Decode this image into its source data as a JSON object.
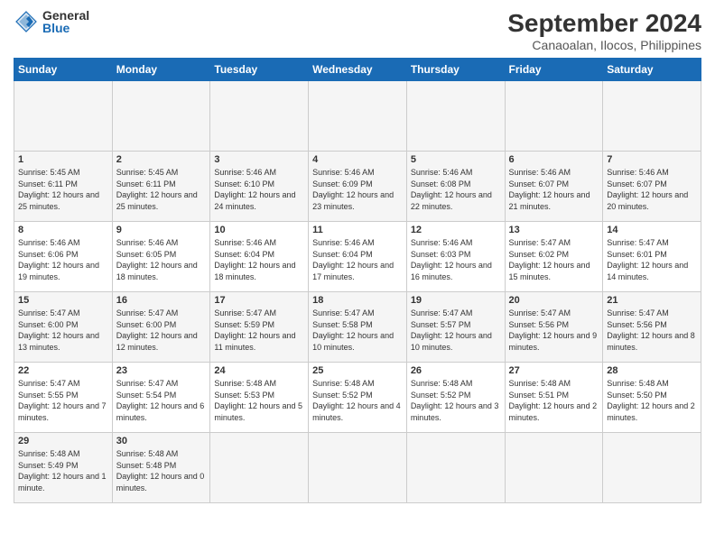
{
  "header": {
    "logo_general": "General",
    "logo_blue": "Blue",
    "title": "September 2024",
    "subtitle": "Canaoalan, Ilocos, Philippines"
  },
  "calendar": {
    "headers": [
      "Sunday",
      "Monday",
      "Tuesday",
      "Wednesday",
      "Thursday",
      "Friday",
      "Saturday"
    ],
    "weeks": [
      [
        {
          "day": "",
          "info": ""
        },
        {
          "day": "",
          "info": ""
        },
        {
          "day": "",
          "info": ""
        },
        {
          "day": "",
          "info": ""
        },
        {
          "day": "",
          "info": ""
        },
        {
          "day": "",
          "info": ""
        },
        {
          "day": "",
          "info": ""
        }
      ],
      [
        {
          "day": "1",
          "sunrise": "Sunrise: 5:45 AM",
          "sunset": "Sunset: 6:11 PM",
          "daylight": "Daylight: 12 hours and 25 minutes."
        },
        {
          "day": "2",
          "sunrise": "Sunrise: 5:45 AM",
          "sunset": "Sunset: 6:11 PM",
          "daylight": "Daylight: 12 hours and 25 minutes."
        },
        {
          "day": "3",
          "sunrise": "Sunrise: 5:46 AM",
          "sunset": "Sunset: 6:10 PM",
          "daylight": "Daylight: 12 hours and 24 minutes."
        },
        {
          "day": "4",
          "sunrise": "Sunrise: 5:46 AM",
          "sunset": "Sunset: 6:09 PM",
          "daylight": "Daylight: 12 hours and 23 minutes."
        },
        {
          "day": "5",
          "sunrise": "Sunrise: 5:46 AM",
          "sunset": "Sunset: 6:08 PM",
          "daylight": "Daylight: 12 hours and 22 minutes."
        },
        {
          "day": "6",
          "sunrise": "Sunrise: 5:46 AM",
          "sunset": "Sunset: 6:07 PM",
          "daylight": "Daylight: 12 hours and 21 minutes."
        },
        {
          "day": "7",
          "sunrise": "Sunrise: 5:46 AM",
          "sunset": "Sunset: 6:07 PM",
          "daylight": "Daylight: 12 hours and 20 minutes."
        }
      ],
      [
        {
          "day": "8",
          "sunrise": "Sunrise: 5:46 AM",
          "sunset": "Sunset: 6:06 PM",
          "daylight": "Daylight: 12 hours and 19 minutes."
        },
        {
          "day": "9",
          "sunrise": "Sunrise: 5:46 AM",
          "sunset": "Sunset: 6:05 PM",
          "daylight": "Daylight: 12 hours and 18 minutes."
        },
        {
          "day": "10",
          "sunrise": "Sunrise: 5:46 AM",
          "sunset": "Sunset: 6:04 PM",
          "daylight": "Daylight: 12 hours and 18 minutes."
        },
        {
          "day": "11",
          "sunrise": "Sunrise: 5:46 AM",
          "sunset": "Sunset: 6:04 PM",
          "daylight": "Daylight: 12 hours and 17 minutes."
        },
        {
          "day": "12",
          "sunrise": "Sunrise: 5:46 AM",
          "sunset": "Sunset: 6:03 PM",
          "daylight": "Daylight: 12 hours and 16 minutes."
        },
        {
          "day": "13",
          "sunrise": "Sunrise: 5:47 AM",
          "sunset": "Sunset: 6:02 PM",
          "daylight": "Daylight: 12 hours and 15 minutes."
        },
        {
          "day": "14",
          "sunrise": "Sunrise: 5:47 AM",
          "sunset": "Sunset: 6:01 PM",
          "daylight": "Daylight: 12 hours and 14 minutes."
        }
      ],
      [
        {
          "day": "15",
          "sunrise": "Sunrise: 5:47 AM",
          "sunset": "Sunset: 6:00 PM",
          "daylight": "Daylight: 12 hours and 13 minutes."
        },
        {
          "day": "16",
          "sunrise": "Sunrise: 5:47 AM",
          "sunset": "Sunset: 6:00 PM",
          "daylight": "Daylight: 12 hours and 12 minutes."
        },
        {
          "day": "17",
          "sunrise": "Sunrise: 5:47 AM",
          "sunset": "Sunset: 5:59 PM",
          "daylight": "Daylight: 12 hours and 11 minutes."
        },
        {
          "day": "18",
          "sunrise": "Sunrise: 5:47 AM",
          "sunset": "Sunset: 5:58 PM",
          "daylight": "Daylight: 12 hours and 10 minutes."
        },
        {
          "day": "19",
          "sunrise": "Sunrise: 5:47 AM",
          "sunset": "Sunset: 5:57 PM",
          "daylight": "Daylight: 12 hours and 10 minutes."
        },
        {
          "day": "20",
          "sunrise": "Sunrise: 5:47 AM",
          "sunset": "Sunset: 5:56 PM",
          "daylight": "Daylight: 12 hours and 9 minutes."
        },
        {
          "day": "21",
          "sunrise": "Sunrise: 5:47 AM",
          "sunset": "Sunset: 5:56 PM",
          "daylight": "Daylight: 12 hours and 8 minutes."
        }
      ],
      [
        {
          "day": "22",
          "sunrise": "Sunrise: 5:47 AM",
          "sunset": "Sunset: 5:55 PM",
          "daylight": "Daylight: 12 hours and 7 minutes."
        },
        {
          "day": "23",
          "sunrise": "Sunrise: 5:47 AM",
          "sunset": "Sunset: 5:54 PM",
          "daylight": "Daylight: 12 hours and 6 minutes."
        },
        {
          "day": "24",
          "sunrise": "Sunrise: 5:48 AM",
          "sunset": "Sunset: 5:53 PM",
          "daylight": "Daylight: 12 hours and 5 minutes."
        },
        {
          "day": "25",
          "sunrise": "Sunrise: 5:48 AM",
          "sunset": "Sunset: 5:52 PM",
          "daylight": "Daylight: 12 hours and 4 minutes."
        },
        {
          "day": "26",
          "sunrise": "Sunrise: 5:48 AM",
          "sunset": "Sunset: 5:52 PM",
          "daylight": "Daylight: 12 hours and 3 minutes."
        },
        {
          "day": "27",
          "sunrise": "Sunrise: 5:48 AM",
          "sunset": "Sunset: 5:51 PM",
          "daylight": "Daylight: 12 hours and 2 minutes."
        },
        {
          "day": "28",
          "sunrise": "Sunrise: 5:48 AM",
          "sunset": "Sunset: 5:50 PM",
          "daylight": "Daylight: 12 hours and 2 minutes."
        }
      ],
      [
        {
          "day": "29",
          "sunrise": "Sunrise: 5:48 AM",
          "sunset": "Sunset: 5:49 PM",
          "daylight": "Daylight: 12 hours and 1 minute."
        },
        {
          "day": "30",
          "sunrise": "Sunrise: 5:48 AM",
          "sunset": "Sunset: 5:48 PM",
          "daylight": "Daylight: 12 hours and 0 minutes."
        },
        {
          "day": "",
          "info": ""
        },
        {
          "day": "",
          "info": ""
        },
        {
          "day": "",
          "info": ""
        },
        {
          "day": "",
          "info": ""
        },
        {
          "day": "",
          "info": ""
        }
      ]
    ]
  }
}
